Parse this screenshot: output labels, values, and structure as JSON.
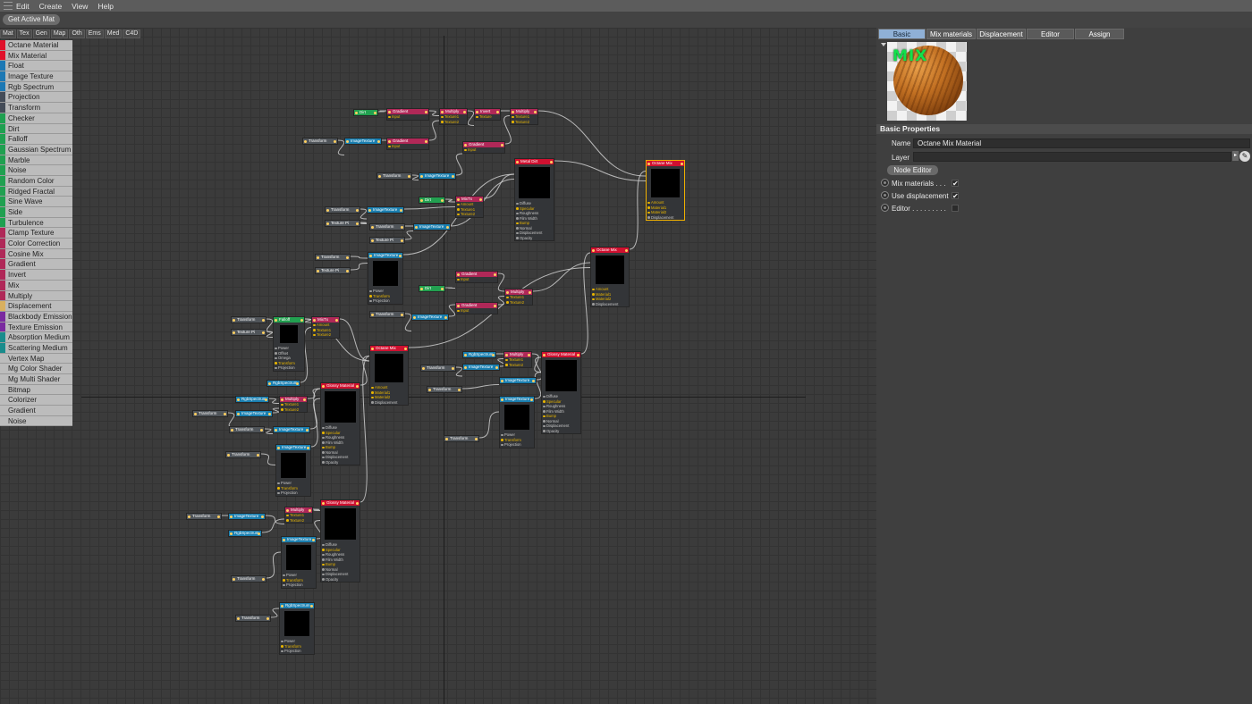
{
  "menubar": {
    "items": [
      "Edit",
      "Create",
      "View",
      "Help"
    ]
  },
  "toolbar": {
    "get_active_mat": "Get Active Mat"
  },
  "category_tabs": [
    "Mat",
    "Tex",
    "Gen",
    "Map",
    "Oth",
    "Ems",
    "Med",
    "C4D"
  ],
  "palette": [
    {
      "label": "Octane Material",
      "color": "#e0102a"
    },
    {
      "label": "Mix Material",
      "color": "#e0102a"
    },
    {
      "label": "Float",
      "color": "#1c78b4"
    },
    {
      "label": "Image Texture",
      "color": "#1c78b4"
    },
    {
      "label": "Rgb Spectrum",
      "color": "#1c78b4"
    },
    {
      "label": "Projection",
      "color": "#444c58"
    },
    {
      "label": "Transform",
      "color": "#444c58"
    },
    {
      "label": "Checker",
      "color": "#1fa050"
    },
    {
      "label": "Dirt",
      "color": "#1fa050"
    },
    {
      "label": "Falloff",
      "color": "#1fa050"
    },
    {
      "label": "Gaussian Spectrum",
      "color": "#1fa050"
    },
    {
      "label": "Marble",
      "color": "#1fa050"
    },
    {
      "label": "Noise",
      "color": "#1fa050"
    },
    {
      "label": "Random Color",
      "color": "#1fa050"
    },
    {
      "label": "Ridged Fractal",
      "color": "#1fa050"
    },
    {
      "label": "Sine Wave",
      "color": "#1fa050"
    },
    {
      "label": "Side",
      "color": "#1fa050"
    },
    {
      "label": "Turbulence",
      "color": "#1fa050"
    },
    {
      "label": "Clamp Texture",
      "color": "#b02858"
    },
    {
      "label": "Color Correction",
      "color": "#b02858"
    },
    {
      "label": "Cosine Mix",
      "color": "#b02858"
    },
    {
      "label": "Gradient",
      "color": "#b02858"
    },
    {
      "label": "Invert",
      "color": "#b02858"
    },
    {
      "label": "Mix",
      "color": "#b02858"
    },
    {
      "label": "Multiply",
      "color": "#b02858"
    },
    {
      "label": "Displacement",
      "color": "#d8b060"
    },
    {
      "label": "Blackbody Emission",
      "color": "#7a2aa0"
    },
    {
      "label": "Texture Emission",
      "color": "#7a2aa0"
    },
    {
      "label": "Absorption Medium",
      "color": "#1a8c8c"
    },
    {
      "label": "Scattering Medium",
      "color": "#1a8c8c"
    },
    {
      "label": "Vertex Map",
      "color": "#bcbcbc"
    },
    {
      "label": "Mg Color Shader",
      "color": "#bcbcbc"
    },
    {
      "label": "Mg Multi Shader",
      "color": "#bcbcbc"
    },
    {
      "label": "Bitmap",
      "color": "#bcbcbc"
    },
    {
      "label": "Colorizer",
      "color": "#bcbcbc"
    },
    {
      "label": "Gradient",
      "color": "#bcbcbc"
    },
    {
      "label": "Noise",
      "color": "#bcbcbc"
    }
  ],
  "nodes": {
    "dirt_top": "Dirt",
    "gradient_a": "Gradient",
    "gradient_b": "Gradient",
    "gradient_c": "Gradient",
    "multiply_a": "Multiply",
    "invert": "Invert",
    "multiply_b": "Multiply",
    "transform_a": "Transform",
    "imagetex_a": "ImageTexture",
    "transform_b": "Transform",
    "imagetex_b": "ImageTexture",
    "metal_dirt": "Metal Dirt",
    "octane_mix_main": "Octane Mix",
    "dirt_b": "Dirt",
    "mixtx": "MixTx",
    "transform_c": "Transform",
    "texture_pi_a": "Texture Pi",
    "imagetex_c": "ImageTexture",
    "transform_d": "Transform",
    "texture_pi_b": "Texture Pi",
    "imagetex_d": "ImageTexture",
    "transform_e": "Transform",
    "texture_pi_c": "Texture Pi",
    "imagetex_e": "ImageTexture",
    "dirt_c": "Dirt",
    "gradient_d": "Gradient",
    "gradient_e": "Gradient",
    "multiply_c": "Multiply",
    "transform_f": "Transform",
    "imagetex_f": "ImageTexture",
    "octane_mix_b": "Octane Mix",
    "transform_g": "Transform",
    "texture_pi_d": "Texture Pi",
    "falloff": "Falloff",
    "mixtx_b": "MixTx",
    "rgbspectrum_a": "RgbSpectrum",
    "octane_mix_c": "Octane Mix",
    "rgbspectrum_b": "RgbSpectrum",
    "multiply_d": "Multiply",
    "transform_h": "Transform",
    "imagetex_g": "ImageTexture",
    "glossy_a": "Glossy Material",
    "transform_i": "Transform",
    "imagetex_h": "ImageTexture",
    "transform_j": "Transform",
    "imagetex_i": "ImageTexture",
    "rgbspectrum_c": "RgbSpectrum",
    "transform_k": "Transform",
    "imagetex_j": "ImageTexture",
    "multiply_e": "Multiply",
    "glossy_b": "Glossy Material",
    "transform_l": "Transform",
    "transform_m": "Transform",
    "imagetex_k": "ImageTexture",
    "transform_n": "Transform",
    "imagetex_l": "ImageTexture",
    "rgbspectrum_d": "RgbSpectrum",
    "multiply_f": "Multiply",
    "glossy_c": "Glossy Material",
    "transform_o": "Transform",
    "imagetex_m": "ImageTexture",
    "transform_p": "Transform",
    "imagetex_n": "ImageTexture",
    "rgbspectrum_e": "RgbSpectrum",
    "rgbspectrum_f": "RgbSpectrum"
  },
  "ports": {
    "input": "Input",
    "texture": "Texture",
    "texture1": "Texture1",
    "texture2": "Texture2",
    "amount": "Amount",
    "material1": "Material1",
    "material2": "Material2",
    "displacement": "Displacement",
    "diffuse": "Diffuse",
    "specular": "Specular",
    "roughness": "Roughness",
    "film_width": "Film Width",
    "bump": "Bump",
    "normal": "Normal",
    "opacity": "Opacity",
    "power": "Power",
    "transform": "Transform",
    "projection": "Projection",
    "offset": "Offset",
    "omega": "Omega"
  },
  "right_panel": {
    "tabs": [
      "Basic",
      "Mix materials",
      "Displacement",
      "Editor",
      "Assign"
    ],
    "active_tab": "Basic",
    "thumb_label": "MIX",
    "basic_properties": "Basic Properties",
    "name_label": "Name",
    "name_value": "Octane Mix Material",
    "layer_label": "Layer",
    "layer_value": "",
    "node_editor": "Node Editor",
    "options": [
      {
        "label": "Mix materials . . .",
        "checked": true,
        "mark": "✔"
      },
      {
        "label": "Use displacement",
        "checked": true,
        "mark": "✔"
      },
      {
        "label": "Editor . . . . . . . . .",
        "checked": false,
        "mark": ""
      }
    ]
  }
}
